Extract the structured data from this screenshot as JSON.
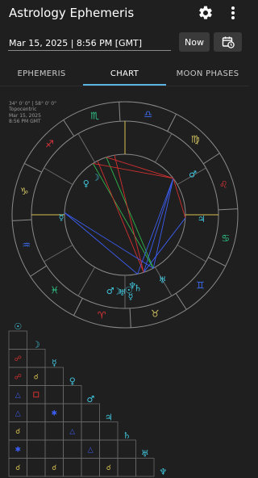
{
  "app": {
    "title": "Astrology Ephemeris"
  },
  "toolbar": {
    "settings_icon": "gear-icon",
    "menu_icon": "more-vert-icon"
  },
  "date_field": {
    "value": "Mar 15, 2025 | 8:56 PM [GMT]"
  },
  "now_button": {
    "label": "Now"
  },
  "calendar_button": {
    "icon": "calendar-clock-icon"
  },
  "tabs": [
    {
      "label": "EPHEMERIS",
      "active": false
    },
    {
      "label": "CHART",
      "active": true
    },
    {
      "label": "MOON PHASES",
      "active": false
    }
  ],
  "chart_info": {
    "coords": "34° 0' 0\" | 58° 0' 0\"",
    "system": "Topocentric",
    "date": "Mar 15, 2025",
    "time": "8:56 PM GMT"
  },
  "colors": {
    "accent": "#5ab3e0",
    "planet": "#40c8e0",
    "fire": "#e0343c",
    "earth": "#cfc060",
    "air": "#3b6df0",
    "water": "#2ec88a",
    "trine": "#3b5df0",
    "square": "#d23030",
    "sextile": "#2eb84a",
    "conjunction": "#d8c050"
  },
  "zodiac_signs": [
    "aries",
    "taurus",
    "gemini",
    "cancer",
    "leo",
    "virgo",
    "libra",
    "scorpio",
    "sagittarius",
    "capricorn",
    "aquarius",
    "pisces"
  ],
  "zodiac_glyphs": [
    "♈",
    "♉",
    "♊",
    "♋",
    "♌",
    "♍",
    "♎",
    "♏",
    "♐",
    "♑",
    "♒",
    "♓"
  ],
  "planets": [
    {
      "name": "sun",
      "glyph": "☉"
    },
    {
      "name": "moon",
      "glyph": "☽"
    },
    {
      "name": "mercury",
      "glyph": "☿"
    },
    {
      "name": "venus",
      "glyph": "♀"
    },
    {
      "name": "mars",
      "glyph": "♂"
    },
    {
      "name": "jupiter",
      "glyph": "♃"
    },
    {
      "name": "saturn",
      "glyph": "♄"
    },
    {
      "name": "uranus",
      "glyph": "♅"
    },
    {
      "name": "neptune",
      "glyph": "♆"
    }
  ],
  "aspect_grid": [
    [
      "",
      "",
      "",
      "",
      "",
      "",
      "",
      ""
    ],
    [
      "opposition",
      "",
      "",
      "",
      "",
      "",
      "",
      ""
    ],
    [
      "opposition",
      "conjunction",
      "",
      "",
      "",
      "",
      "",
      ""
    ],
    [
      "trine",
      "square",
      "",
      "",
      "",
      "",
      "",
      ""
    ],
    [
      "trine",
      "",
      "sextile",
      "",
      "",
      "",
      "",
      ""
    ],
    [
      "conjunction",
      "",
      "",
      "trine",
      "",
      "",
      "",
      ""
    ],
    [
      "sextile",
      "",
      "",
      "",
      "trine",
      "",
      "",
      ""
    ],
    [
      "conjunction",
      "",
      "conjunction",
      "",
      "",
      "conjunction",
      "",
      ""
    ]
  ]
}
